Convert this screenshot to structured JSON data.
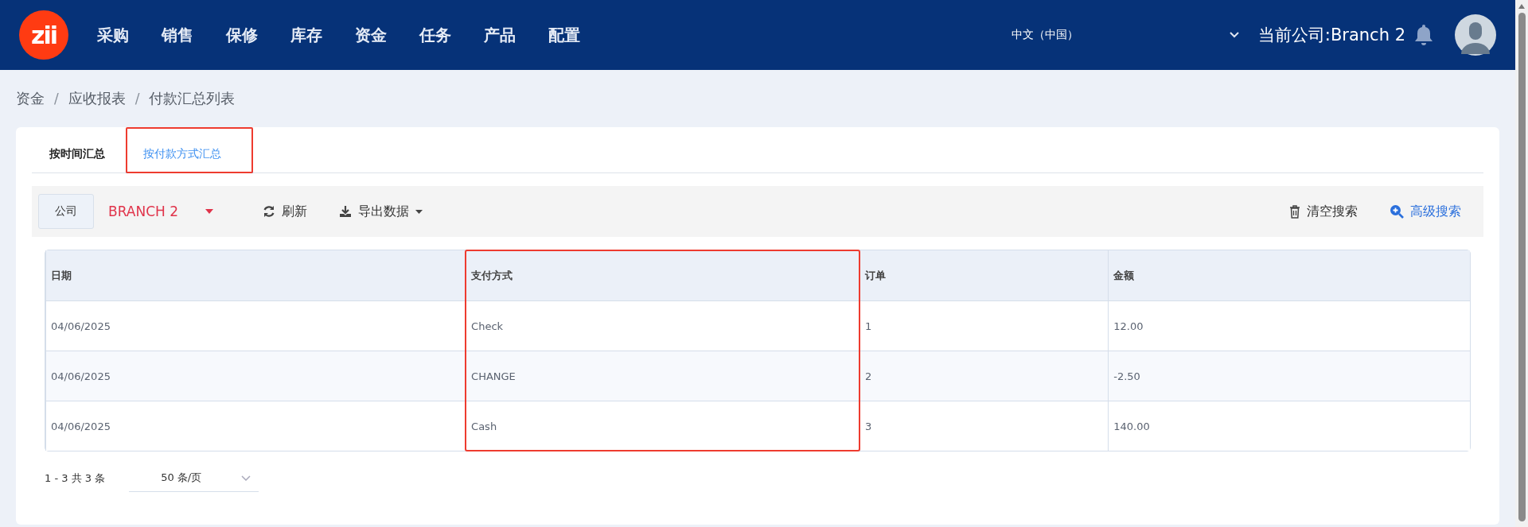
{
  "header": {
    "logo": "zii",
    "nav": [
      "采购",
      "销售",
      "保修",
      "库存",
      "资金",
      "任务",
      "产品",
      "配置"
    ],
    "language": "中文（中国）",
    "current_company": "当前公司:Branch 2"
  },
  "breadcrumb": [
    {
      "kind": "crumb",
      "text": "资金"
    },
    {
      "kind": "separator",
      "text": "/"
    },
    {
      "kind": "crumb",
      "text": "应收报表"
    },
    {
      "kind": "separator",
      "text": "/"
    },
    {
      "kind": "crumb",
      "text": "付款汇总列表"
    }
  ],
  "tabs": [
    {
      "label": "按时间汇总",
      "selected": false,
      "highlighted": false
    },
    {
      "label": "按付款方式汇总",
      "selected": true,
      "highlighted": true
    }
  ],
  "toolbar": {
    "company_label": "公司",
    "company_value": "BRANCH 2",
    "refresh": "刷新",
    "export": "导出数据",
    "clear": "清空搜索",
    "advanced": "高级搜索"
  },
  "table": {
    "columns": [
      {
        "label": "日期",
        "highlighted": false
      },
      {
        "label": "支付方式",
        "highlighted": true
      },
      {
        "label": "订单",
        "highlighted": false
      },
      {
        "label": "金额",
        "highlighted": false
      }
    ],
    "rows": [
      [
        "04/06/2025",
        "Check",
        "1",
        "12.00"
      ],
      [
        "04/06/2025",
        "CHANGE",
        "2",
        "-2.50"
      ],
      [
        "04/06/2025",
        "Cash",
        "3",
        "140.00"
      ]
    ]
  },
  "pager": {
    "summary": "1 - 3 共 3 条",
    "page_size": "50 条/页"
  }
}
